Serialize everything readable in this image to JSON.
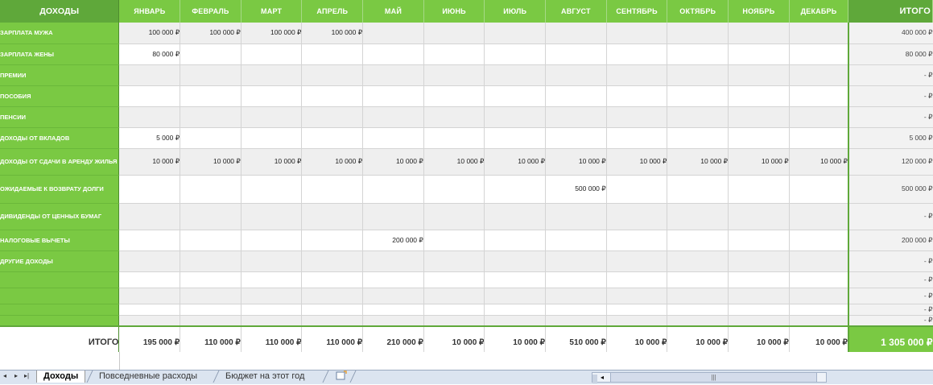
{
  "header": {
    "first": "ДОХОДЫ",
    "months": [
      "ЯНВАРЬ",
      "ФЕВРАЛЬ",
      "МАРТ",
      "АПРЕЛЬ",
      "МАЙ",
      "ИЮНЬ",
      "ИЮЛЬ",
      "АВГУСТ",
      "СЕНТЯБРЬ",
      "ОКТЯБРЬ",
      "НОЯБРЬ",
      "ДЕКАБРЬ"
    ],
    "total": "ИТОГО"
  },
  "rows": [
    {
      "label": "ЗАРПЛАТА МУЖА",
      "values": [
        "100 000 ₽",
        "100 000 ₽",
        "100 000 ₽",
        "100 000 ₽",
        "",
        "",
        "",
        "",
        "",
        "",
        "",
        ""
      ],
      "total": "400 000 ₽"
    },
    {
      "label": "ЗАРПЛАТА ЖЕНЫ",
      "values": [
        "80 000 ₽",
        "",
        "",
        "",
        "",
        "",
        "",
        "",
        "",
        "",
        "",
        ""
      ],
      "total": "80 000 ₽"
    },
    {
      "label": "ПРЕМИИ",
      "values": [
        "",
        "",
        "",
        "",
        "",
        "",
        "",
        "",
        "",
        "",
        "",
        ""
      ],
      "total": "-  ₽"
    },
    {
      "label": "ПОСОБИЯ",
      "values": [
        "",
        "",
        "",
        "",
        "",
        "",
        "",
        "",
        "",
        "",
        "",
        ""
      ],
      "total": "-  ₽"
    },
    {
      "label": "ПЕНСИИ",
      "values": [
        "",
        "",
        "",
        "",
        "",
        "",
        "",
        "",
        "",
        "",
        "",
        ""
      ],
      "total": "-  ₽"
    },
    {
      "label": "ДОХОДЫ ОТ ВКЛАДОВ",
      "values": [
        "5 000 ₽",
        "",
        "",
        "",
        "",
        "",
        "",
        "",
        "",
        "",
        "",
        ""
      ],
      "total": "5 000 ₽"
    },
    {
      "label": "ДОХОДЫ ОТ СДАЧИ В АРЕНДУ ЖИЛЬЯ",
      "values": [
        "10 000 ₽",
        "10 000 ₽",
        "10 000 ₽",
        "10 000 ₽",
        "10 000 ₽",
        "10 000 ₽",
        "10 000 ₽",
        "10 000 ₽",
        "10 000 ₽",
        "10 000 ₽",
        "10 000 ₽",
        "10 000 ₽"
      ],
      "total": "120 000 ₽"
    },
    {
      "label": "ОЖИДАЕМЫЕ К ВОЗВРАТУ ДОЛГИ",
      "values": [
        "",
        "",
        "",
        "",
        "",
        "",
        "",
        "500 000 ₽",
        "",
        "",
        "",
        ""
      ],
      "total": "500 000 ₽"
    },
    {
      "label": "ДИВИДЕНДЫ ОТ ЦЕННЫХ БУМАГ",
      "values": [
        "",
        "",
        "",
        "",
        "",
        "",
        "",
        "",
        "",
        "",
        "",
        ""
      ],
      "total": "-  ₽"
    },
    {
      "label": "НАЛОГОВЫЕ ВЫЧЕТЫ",
      "values": [
        "",
        "",
        "",
        "",
        "200 000 ₽",
        "",
        "",
        "",
        "",
        "",
        "",
        ""
      ],
      "total": "200 000 ₽"
    },
    {
      "label": "ДРУГИЕ ДОХОДЫ",
      "values": [
        "",
        "",
        "",
        "",
        "",
        "",
        "",
        "",
        "",
        "",
        "",
        ""
      ],
      "total": "-  ₽"
    },
    {
      "label": "",
      "values": [
        "",
        "",
        "",
        "",
        "",
        "",
        "",
        "",
        "",
        "",
        "",
        ""
      ],
      "total": "-  ₽"
    },
    {
      "label": "",
      "values": [
        "",
        "",
        "",
        "",
        "",
        "",
        "",
        "",
        "",
        "",
        "",
        ""
      ],
      "total": "-  ₽"
    },
    {
      "label": "",
      "values": [
        "",
        "",
        "",
        "",
        "",
        "",
        "",
        "",
        "",
        "",
        "",
        ""
      ],
      "total": "-  ₽"
    },
    {
      "label": "",
      "values": [
        "",
        "",
        "",
        "",
        "",
        "",
        "",
        "",
        "",
        "",
        "",
        ""
      ],
      "total": "-  ₽"
    }
  ],
  "totals": {
    "label": "ИТОГО",
    "values": [
      "195 000 ₽",
      "110 000 ₽",
      "110 000 ₽",
      "110 000 ₽",
      "210 000 ₽",
      "10 000 ₽",
      "10 000 ₽",
      "510 000 ₽",
      "10 000 ₽",
      "10 000 ₽",
      "10 000 ₽",
      "10 000 ₽"
    ],
    "grand": "1 305 000 ₽"
  },
  "tabs": {
    "nav": [
      "◂",
      "▸",
      "▸|"
    ],
    "sheets": [
      "Доходы",
      "Повседневные расходы",
      "Бюджет на этот год"
    ],
    "add_icon": "new-sheet-icon"
  },
  "colors": {
    "green": "#7ac943",
    "dark_green": "#5fa83a"
  }
}
